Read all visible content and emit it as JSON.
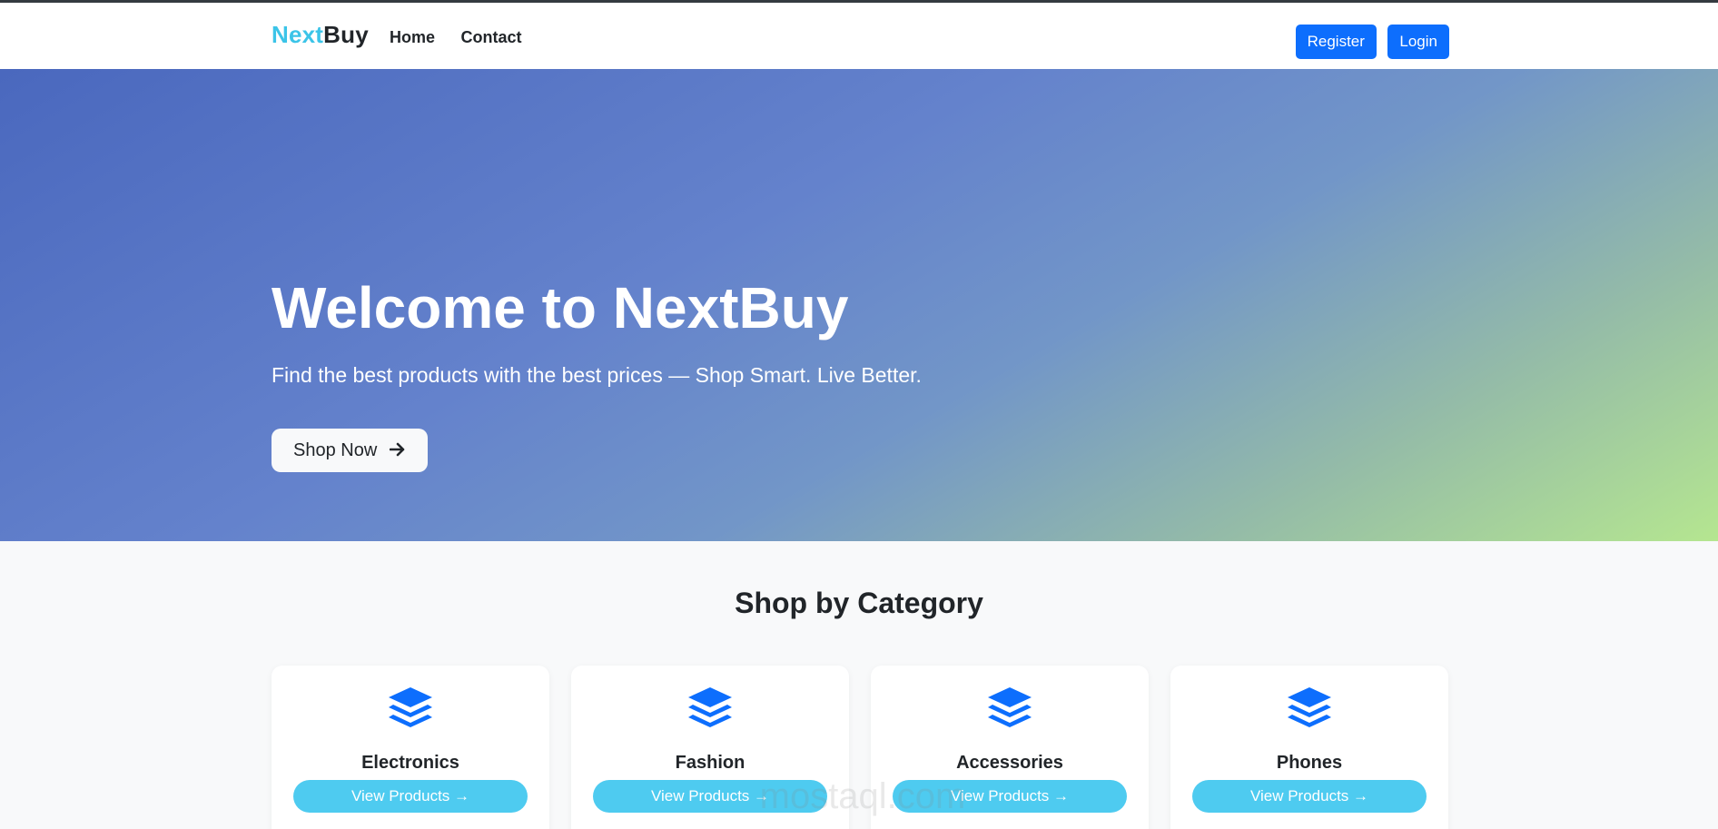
{
  "navbar": {
    "brand_part1": "Next",
    "brand_part2": "Buy",
    "links": [
      "Home",
      "Contact"
    ],
    "register_label": "Register",
    "login_label": "Login"
  },
  "hero": {
    "title": "Welcome to NextBuy",
    "subtitle": "Find the best products with the best prices — Shop Smart. Live Better.",
    "cta_label": "Shop Now",
    "cta_icon": "arrow-right-icon"
  },
  "categories": {
    "title": "Shop by Category",
    "items": [
      {
        "name": "Electronics",
        "button_label": "View Products →",
        "icon": "layers-icon"
      },
      {
        "name": "Fashion",
        "button_label": "View Products →",
        "icon": "layers-icon"
      },
      {
        "name": "Accessories",
        "button_label": "View Products →",
        "icon": "layers-icon"
      },
      {
        "name": "Phones",
        "button_label": "View Products →",
        "icon": "layers-icon"
      }
    ]
  },
  "colors": {
    "brand_accent": "#3bc4e8",
    "primary_button": "#0d6efd",
    "category_button": "#4ecbf0",
    "icon_color": "#0d6efd"
  },
  "watermark": "mostaql.com"
}
